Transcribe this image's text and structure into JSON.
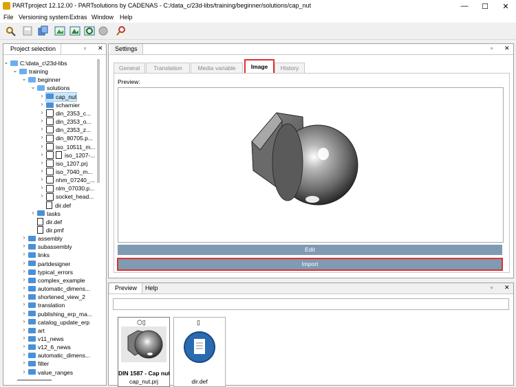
{
  "window": {
    "title": "PARTproject 12.12.00 - PARTsolutions by CADENAS - C:/data_c/23d-libs/training/beginner/solutions/cap_nut",
    "controls": [
      "—",
      "☐",
      "✕"
    ]
  },
  "menu": [
    "File",
    "Versioning system",
    "Extras",
    "Window",
    "Help"
  ],
  "toolbar": [
    "new-icon",
    "save-icon",
    "copy-icon",
    "image-green-icon",
    "image-green2-icon",
    "gear-icon",
    "globe-icon",
    "search-icon"
  ],
  "project_panel": {
    "title": "Project selection",
    "tree": [
      {
        "label": "C:\\data_c\\23d-libs",
        "type": "folder-open",
        "level": 0,
        "expander": "v"
      },
      {
        "label": "training",
        "type": "folder-open",
        "level": 1,
        "expander": "v"
      },
      {
        "label": "beginner",
        "type": "folder-open",
        "level": 2,
        "expander": "v"
      },
      {
        "label": "solutions",
        "type": "folder-open",
        "level": 3,
        "expander": "v"
      },
      {
        "label": "cap_nut",
        "type": "folder",
        "level": 4,
        "expander": ">",
        "selected": true
      },
      {
        "label": "scharnier",
        "type": "folder",
        "level": 4,
        "expander": ">"
      },
      {
        "label": "din_2353_c...",
        "type": "part",
        "level": 4,
        "expander": ">"
      },
      {
        "label": "din_2353_o...",
        "type": "part",
        "level": 4,
        "expander": ">"
      },
      {
        "label": "din_2353_z...",
        "type": "part",
        "level": 4,
        "expander": ">"
      },
      {
        "label": "din_80705.p...",
        "type": "part",
        "level": 4,
        "expander": ">"
      },
      {
        "label": "iso_10511_m...",
        "type": "part",
        "level": 4,
        "expander": ">"
      },
      {
        "label": "iso_1207-...",
        "type": "part-doc",
        "level": 4,
        "expander": ">"
      },
      {
        "label": "iso_1207.prj",
        "type": "part",
        "level": 4,
        "expander": ">"
      },
      {
        "label": "iso_7040_m...",
        "type": "part",
        "level": 4,
        "expander": ">"
      },
      {
        "label": "nhm_07240_...",
        "type": "part",
        "level": 4,
        "expander": ">"
      },
      {
        "label": "nlm_07030.p...",
        "type": "part",
        "level": 4,
        "expander": ">"
      },
      {
        "label": "socket_head...",
        "type": "part",
        "level": 4,
        "expander": ">"
      },
      {
        "label": "dir.def",
        "type": "doc",
        "level": 4,
        "expander": ""
      },
      {
        "label": "tasks",
        "type": "folder",
        "level": 3,
        "expander": ">"
      },
      {
        "label": "dir.def",
        "type": "doc",
        "level": 3,
        "expander": ""
      },
      {
        "label": "dir.pmf",
        "type": "doc",
        "level": 3,
        "expander": ""
      },
      {
        "label": "assembly",
        "type": "folder",
        "level": 2,
        "expander": ">"
      },
      {
        "label": "subassembly",
        "type": "folder",
        "level": 2,
        "expander": ">"
      },
      {
        "label": "links",
        "type": "folder",
        "level": 2,
        "expander": ">"
      },
      {
        "label": "partdesigner",
        "type": "folder",
        "level": 2,
        "expander": ">"
      },
      {
        "label": "typical_errors",
        "type": "folder",
        "level": 2,
        "expander": ">"
      },
      {
        "label": "complex_example",
        "type": "folder",
        "level": 2,
        "expander": ">"
      },
      {
        "label": "automatic_dimens...",
        "type": "folder",
        "level": 2,
        "expander": ">"
      },
      {
        "label": "shortened_view_2",
        "type": "folder",
        "level": 2,
        "expander": ">"
      },
      {
        "label": "translation",
        "type": "folder",
        "level": 2,
        "expander": ">"
      },
      {
        "label": "publishing_erp_ma...",
        "type": "folder",
        "level": 2,
        "expander": ">"
      },
      {
        "label": "catalog_update_erp",
        "type": "folder",
        "level": 2,
        "expander": ">"
      },
      {
        "label": "art",
        "type": "folder",
        "level": 2,
        "expander": ">"
      },
      {
        "label": "v11_news",
        "type": "folder",
        "level": 2,
        "expander": ">"
      },
      {
        "label": "v12_6_news",
        "type": "folder",
        "level": 2,
        "expander": ">"
      },
      {
        "label": "automatic_dimens...",
        "type": "folder",
        "level": 2,
        "expander": ">"
      },
      {
        "label": "filter",
        "type": "folder",
        "level": 2,
        "expander": ">"
      },
      {
        "label": "value_ranges",
        "type": "folder",
        "level": 2,
        "expander": ">"
      }
    ]
  },
  "settings_panel": {
    "title": "Settings",
    "tabs": [
      "General",
      "Translation",
      "Media variable",
      "Image",
      "History"
    ],
    "active_tab": "Image",
    "preview_label": "Preview:",
    "edit_label": "Edit",
    "import_label": "Import"
  },
  "preview_panel": {
    "tabs": [
      "Preview",
      "Help"
    ],
    "active_tab": "Preview",
    "items": [
      {
        "title": "DIN 1587 - Cap nut",
        "file": "cap_nut.prj"
      },
      {
        "title": "",
        "file": "dir.def"
      }
    ]
  },
  "colors": {
    "highlight": "#e03030",
    "button": "#7f9bb3",
    "folder": "#4a90d9"
  }
}
